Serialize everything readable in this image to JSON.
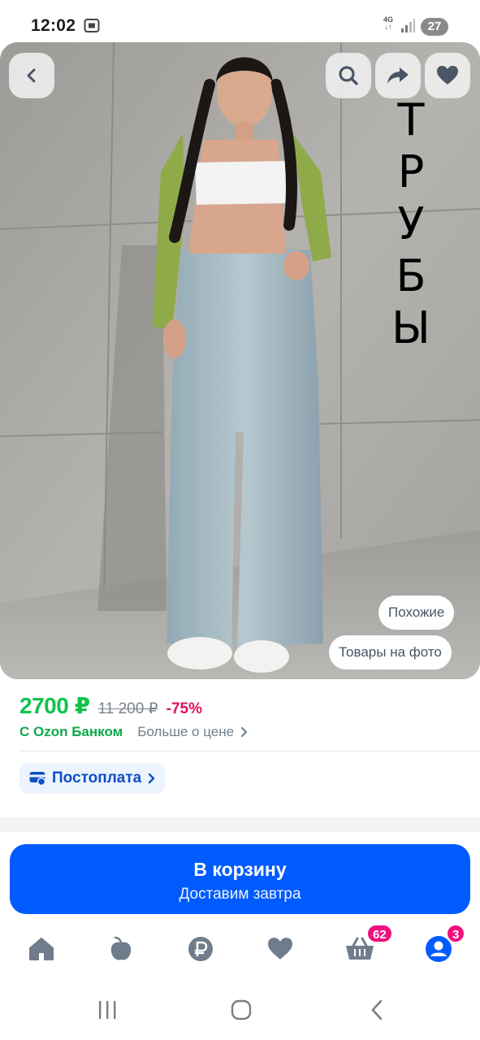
{
  "status_bar": {
    "time": "12:02",
    "network_top": "4G",
    "network_bottom": "↓↑",
    "battery": "27"
  },
  "product_image": {
    "overlay_text_letters": [
      "Т",
      "Р",
      "У",
      "Б",
      "Ы"
    ],
    "chip_similar": "Похожие",
    "chip_on_photo": "Товары на фото",
    "icons": [
      "back-icon",
      "search-icon",
      "share-icon",
      "heart-icon"
    ]
  },
  "price": {
    "current": "2700 ₽",
    "old": "11 200 ₽",
    "discount": "-75%",
    "bank_label": "С Ozon Банком",
    "more_about_price": "Больше о цене"
  },
  "postpay": {
    "label": "Постоплата"
  },
  "cart_button": {
    "title": "В корзину",
    "subtitle": "Доставим завтра"
  },
  "tab_bar": {
    "items": [
      {
        "icon": "home-icon"
      },
      {
        "icon": "fresh-icon"
      },
      {
        "icon": "ruble-icon"
      },
      {
        "icon": "favorites-icon"
      },
      {
        "icon": "basket-icon",
        "badge": "62"
      },
      {
        "icon": "profile-icon",
        "badge": "3"
      }
    ]
  },
  "colors": {
    "accent_blue": "#005bff",
    "price_green": "#10c44c",
    "discount_pink": "#e0115f",
    "badge_pink": "#f1117e"
  }
}
